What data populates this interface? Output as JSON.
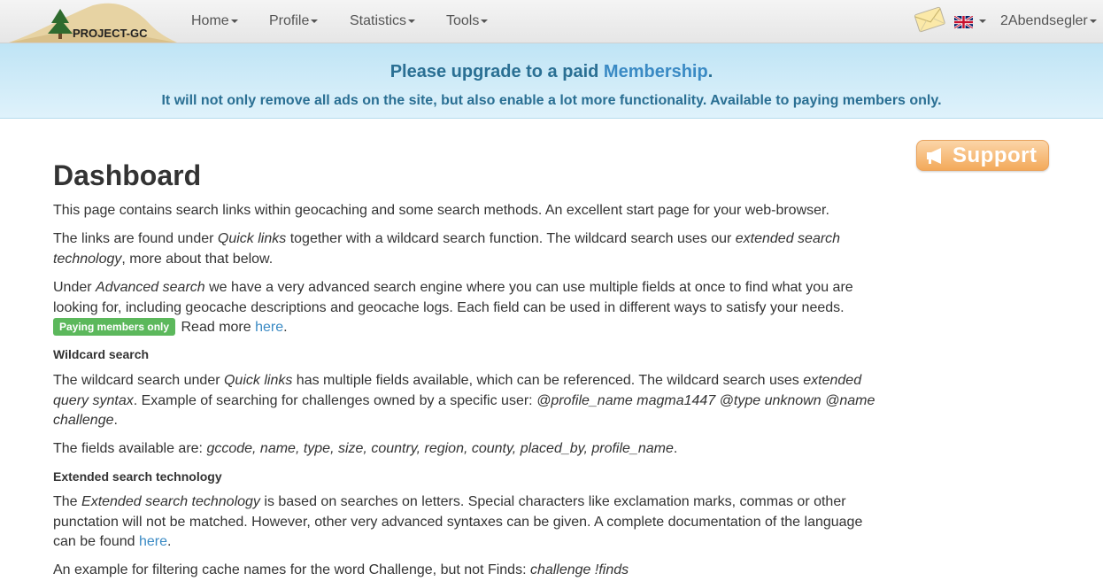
{
  "navbar": {
    "logo_text": "PROJECT-GC",
    "menu": [
      {
        "label": "Home"
      },
      {
        "label": "Profile"
      },
      {
        "label": "Statistics"
      },
      {
        "label": "Tools"
      }
    ],
    "user": "2Abendsegler"
  },
  "banner": {
    "title_prefix": "Please upgrade to a paid ",
    "title_link": "Membership",
    "title_suffix": ".",
    "subtitle": "It will not only remove all ads on the site, but also enable a lot more functionality. Available to paying members only."
  },
  "support": {
    "label": "Support"
  },
  "page": {
    "title": "Dashboard",
    "intro": "This page contains search links within geocaching and some search methods. An excellent start page for your web-browser.",
    "links_a": "The links are found under ",
    "links_b": "Quick links",
    "links_c": " together with a wildcard search function. The wildcard search uses our ",
    "links_d": "extended search technology",
    "links_e": ", more about that below.",
    "adv_a": "Under ",
    "adv_b": "Advanced search",
    "adv_c": " we have a very advanced search engine where you can use multiple fields at once to find what you are looking for, including geocache descriptions and geocache logs. Each field can be used in different ways to satisfy your needs.",
    "badge": "Paying members only",
    "read_more": " Read more ",
    "here1": "here",
    "dot": ".",
    "h_wildcard": "Wildcard search",
    "wc_a": "The wildcard search under ",
    "wc_b": "Quick links",
    "wc_c": " has multiple fields available, which can be referenced. The wildcard search uses ",
    "wc_d": "extended query syntax",
    "wc_e": ". Example of searching for challenges owned by a specific user: ",
    "wc_f": "@profile_name magma1447 @type unknown @name challenge",
    "wc_g": ".",
    "fields_a": "The fields available are: ",
    "fields_b": "gccode, name, type, size, country, region, county, placed_by, profile_name",
    "fields_c": ".",
    "h_extended": "Extended search technology",
    "ext_a": "The ",
    "ext_b": "Extended search technology",
    "ext_c": " is based on searches on letters. Special characters like exclamation marks, commas or other punctation will not be matched. However, other very advanced syntaxes can be given. A complete documentation of the language can be found ",
    "here2": "here",
    "ext_d": ".",
    "example_a": "An example for filtering cache names for the word Challenge, but not Finds: ",
    "example_b": "challenge !finds"
  },
  "colors": {
    "accent": "#3a8ac4",
    "banner_text": "#2a6f93",
    "badge": "#5cb85c",
    "support": "#f3a95a"
  }
}
